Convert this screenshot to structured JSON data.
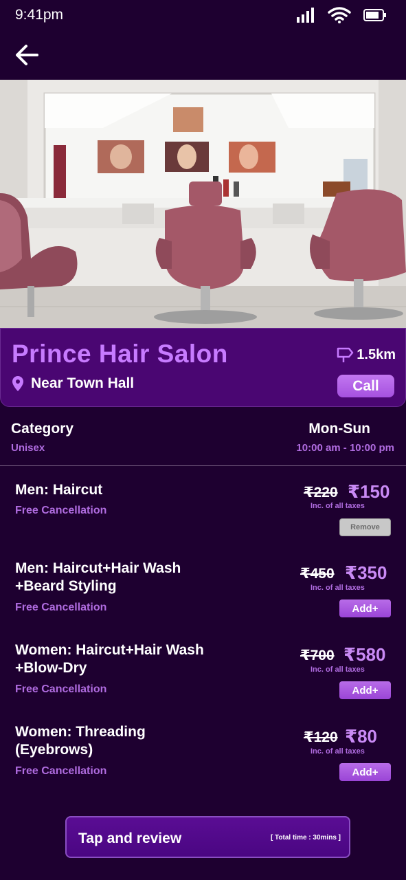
{
  "status_bar": {
    "time": "9:41pm"
  },
  "salon": {
    "name": "Prince Hair Salon",
    "distance": "1.5km",
    "location": "Near Town Hall",
    "call_label": "Call"
  },
  "details": {
    "category_label": "Category",
    "category_value": "Unisex",
    "days_label": "Mon-Sun",
    "hours_value": "10:00 am - 10:00 pm"
  },
  "services": [
    {
      "name": "Men: Haircut",
      "cancel": "Free Cancellation",
      "old_price": "₹220",
      "new_price": "₹150",
      "tax": "Inc. of all taxes",
      "action": "Remove"
    },
    {
      "name_line1": "Men: Haircut+Hair Wash",
      "name_line2": "+Beard Styling",
      "cancel": "Free Cancellation",
      "old_price": "₹450",
      "new_price": "₹350",
      "tax": "Inc. of all taxes",
      "action": "Add+"
    },
    {
      "name_line1": "Women: Haircut+Hair Wash",
      "name_line2": "+Blow-Dry",
      "cancel": "Free Cancellation",
      "old_price": "₹700",
      "new_price": "₹580",
      "tax": "Inc. of all taxes",
      "action": "Add+"
    },
    {
      "name_line1": "Women: Threading",
      "name_line2": "(Eyebrows)",
      "cancel": "Free Cancellation",
      "old_price": "₹120",
      "new_price": "₹80",
      "tax": "Inc. of all taxes",
      "action": "Add+"
    }
  ],
  "review": {
    "label": "Tap and review",
    "total_time": "[ Total time : 30mins ]"
  },
  "colors": {
    "background": "#1e0030",
    "card": "#4a0672",
    "accent": "#c77bff",
    "button": "#a551df"
  },
  "icons": [
    "signal-icon",
    "wifi-icon",
    "battery-icon",
    "back-arrow-icon",
    "signpost-icon",
    "location-pin-icon"
  ]
}
